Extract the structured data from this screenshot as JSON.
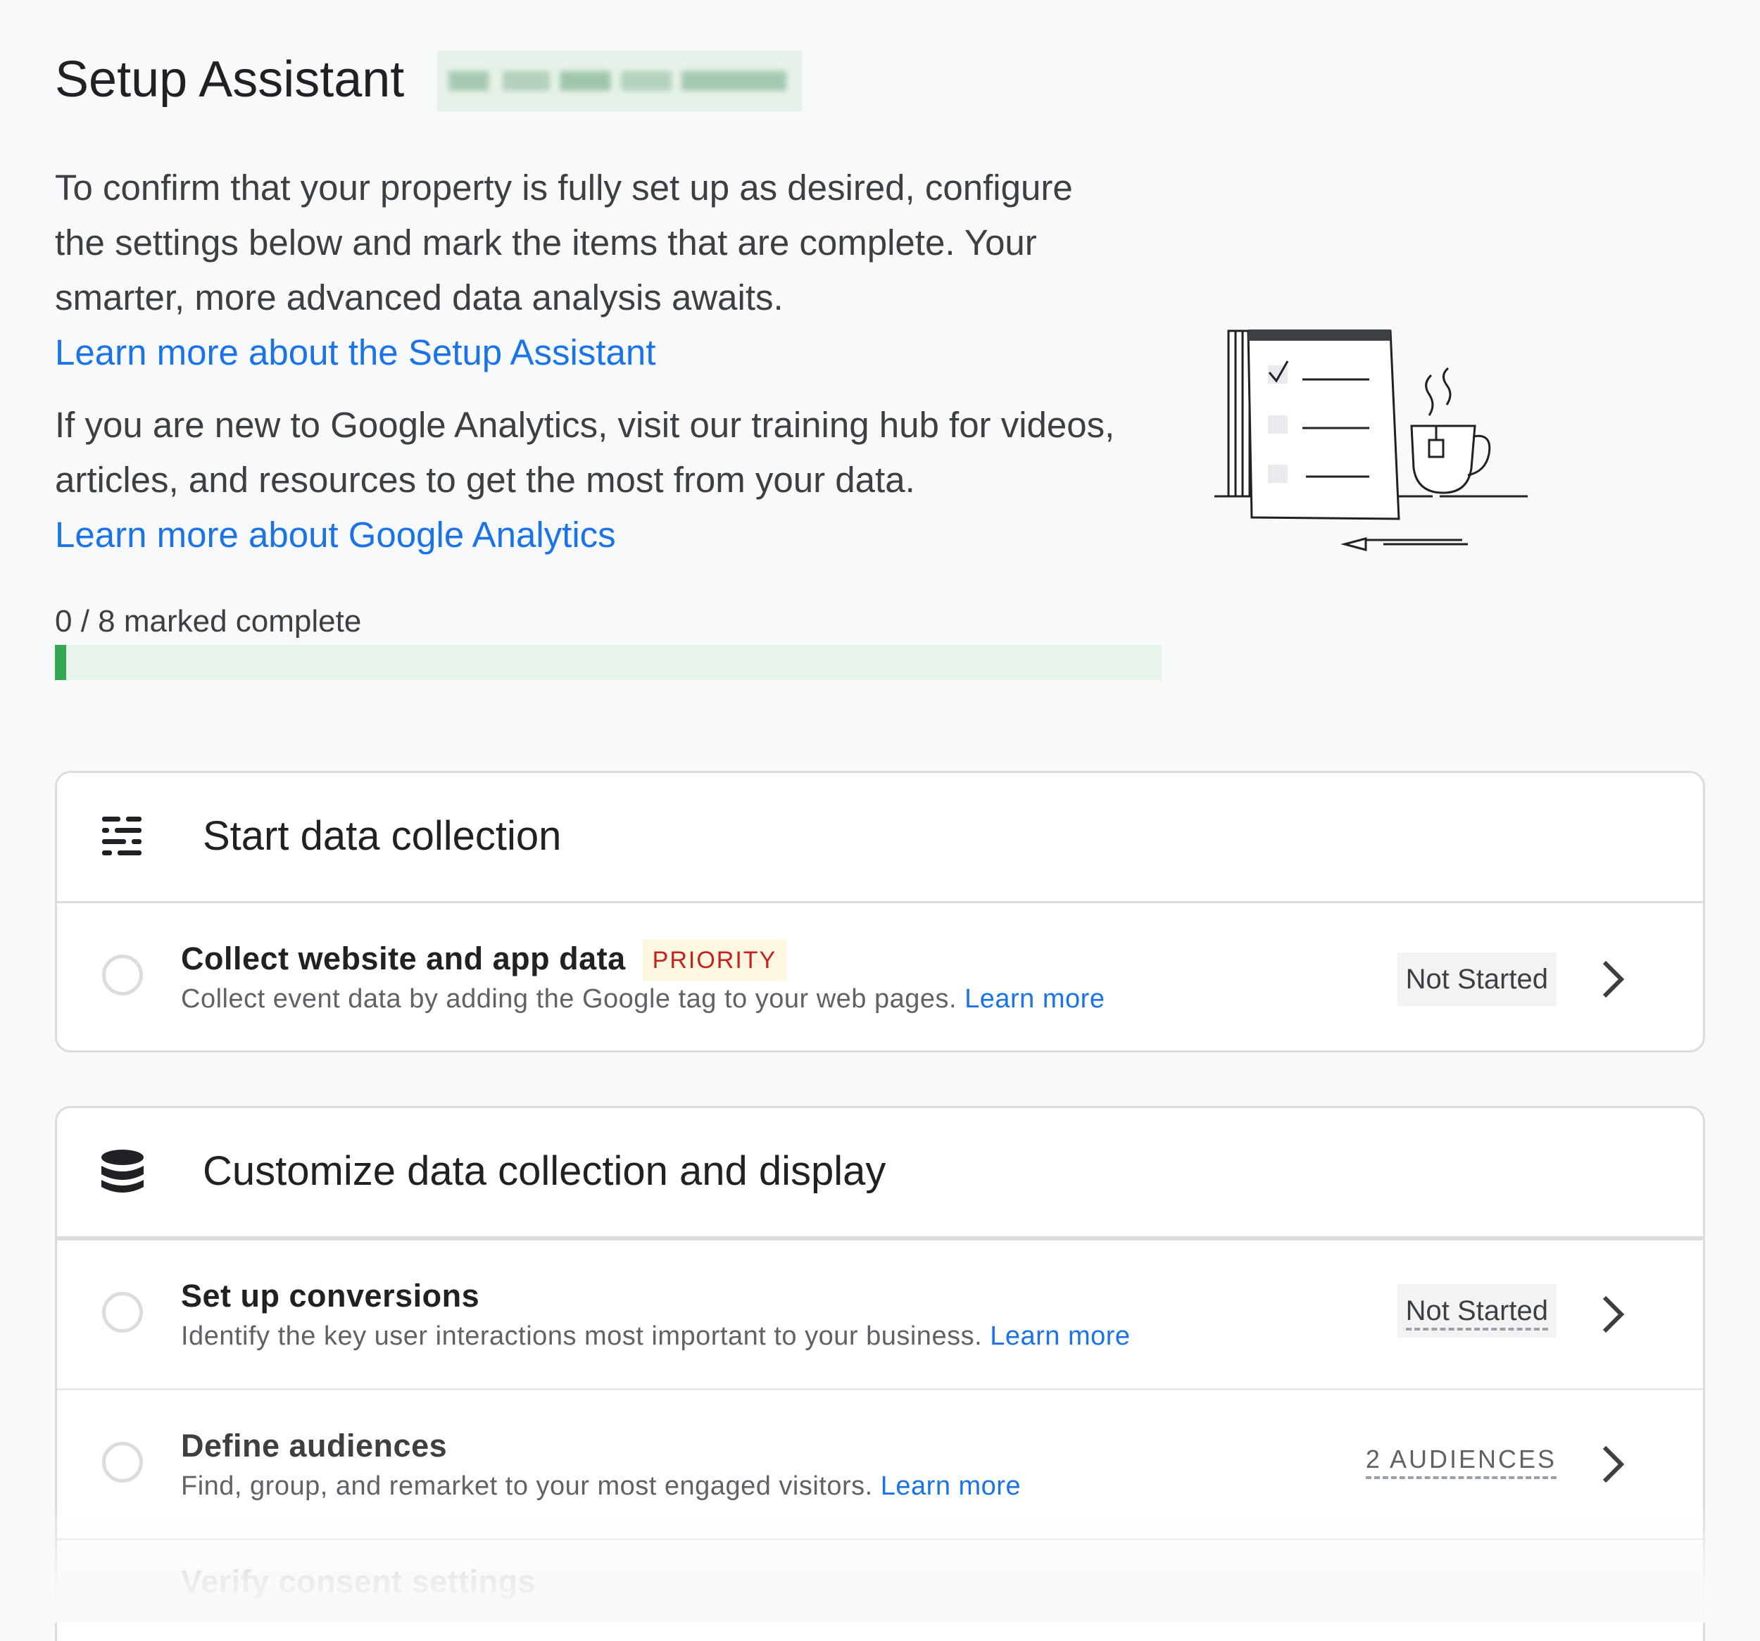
{
  "header": {
    "title": "Setup Assistant"
  },
  "intro": {
    "paragraph1": "To confirm that your property is fully set up as desired, configure the settings below and mark the items that are complete. Your smarter, more advanced data analysis awaits.",
    "link1": "Learn more about the Setup Assistant",
    "paragraph2": "If you are new to Google Analytics, visit our training hub for videos, articles, and resources to get the most from your data.",
    "link2": "Learn more about Google Analytics"
  },
  "progress": {
    "label": "0 / 8 marked complete",
    "completed": 0,
    "total": 8,
    "fill_percent": 1,
    "track_color": "#e6f4ea",
    "fill_color": "#34a853"
  },
  "sections": [
    {
      "title": "Start data collection",
      "icon": "tune-sliders-icon",
      "items": [
        {
          "title": "Collect website and app data",
          "badge": "PRIORITY",
          "description": "Collect event data by adding the Google tag to your web pages.",
          "link": "Learn more",
          "status": "Not Started"
        }
      ]
    },
    {
      "title": "Customize data collection and display",
      "icon": "database-icon",
      "items": [
        {
          "title": "Set up conversions",
          "description": "Identify the key user interactions most important to your business.",
          "link": "Learn more",
          "status": "Not Started"
        },
        {
          "title": "Define audiences",
          "description": "Find, group, and remarket to your most engaged visitors.",
          "link": "Learn more",
          "status": "2 AUDIENCES"
        },
        {
          "title": "Verify consent settings"
        }
      ]
    }
  ],
  "colors": {
    "background": "#f8f9fa",
    "link": "#1a73e8",
    "priority_text": "#c5221f",
    "priority_bg": "#fef7e0"
  }
}
